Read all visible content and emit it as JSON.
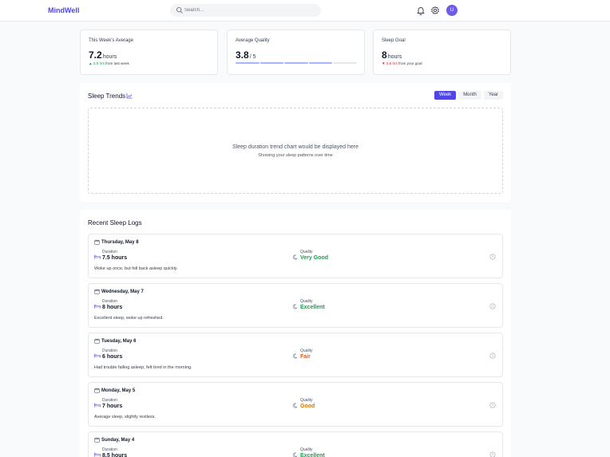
{
  "app": {
    "name": "MindWell"
  },
  "search": {
    "placeholder": "Search..."
  },
  "header": {
    "avatar_initial": "U"
  },
  "stats": {
    "weekly_avg": {
      "label": "This Week's Average",
      "value": "7.2",
      "unit": "hours",
      "change_arrow": "▲",
      "change": "0.5 hrs",
      "change_text": "from last week"
    },
    "avg_quality": {
      "label": "Average Quality",
      "value": "3.8",
      "unit": "/ 5",
      "score": 3.8,
      "max": 5
    },
    "sleep_goal": {
      "label": "Sleep Goal",
      "value": "8",
      "unit": "hours",
      "change_arrow": "▼",
      "change": "0.8 hrs",
      "change_text": "from your goal"
    }
  },
  "trends": {
    "title": "Sleep Trends",
    "tabs": [
      "Week",
      "Month",
      "Year"
    ],
    "active_tab": "Week",
    "placeholder_main": "Sleep duration trend chart would be displayed here",
    "placeholder_sub": "Showing your sleep patterns over time"
  },
  "logs": {
    "title": "Recent Sleep Logs",
    "duration_label": "Duration",
    "quality_label": "Quality",
    "items": [
      {
        "date": "Thursday, May 8",
        "duration": "7.5 hours",
        "quality": "Very Good",
        "note": "Woke up once, but fell back asleep quickly."
      },
      {
        "date": "Wednesday, May 7",
        "duration": "8 hours",
        "quality": "Excellent",
        "note": "Excellent sleep, woke up refreshed."
      },
      {
        "date": "Tuesday, May 6",
        "duration": "6 hours",
        "quality": "Fair",
        "note": "Had trouble falling asleep, felt tired in the morning."
      },
      {
        "date": "Monday, May 5",
        "duration": "7 hours",
        "quality": "Good",
        "note": "Average sleep, slightly restless."
      },
      {
        "date": "Sunday, May 4",
        "duration": "8.5 hours",
        "quality": "Excellent",
        "note": ""
      }
    ]
  },
  "colors": {
    "accent": "#4f46e5",
    "positive": "#16a34a",
    "negative": "#dc2626",
    "fair": "#ea580c",
    "good": "#d97706"
  }
}
